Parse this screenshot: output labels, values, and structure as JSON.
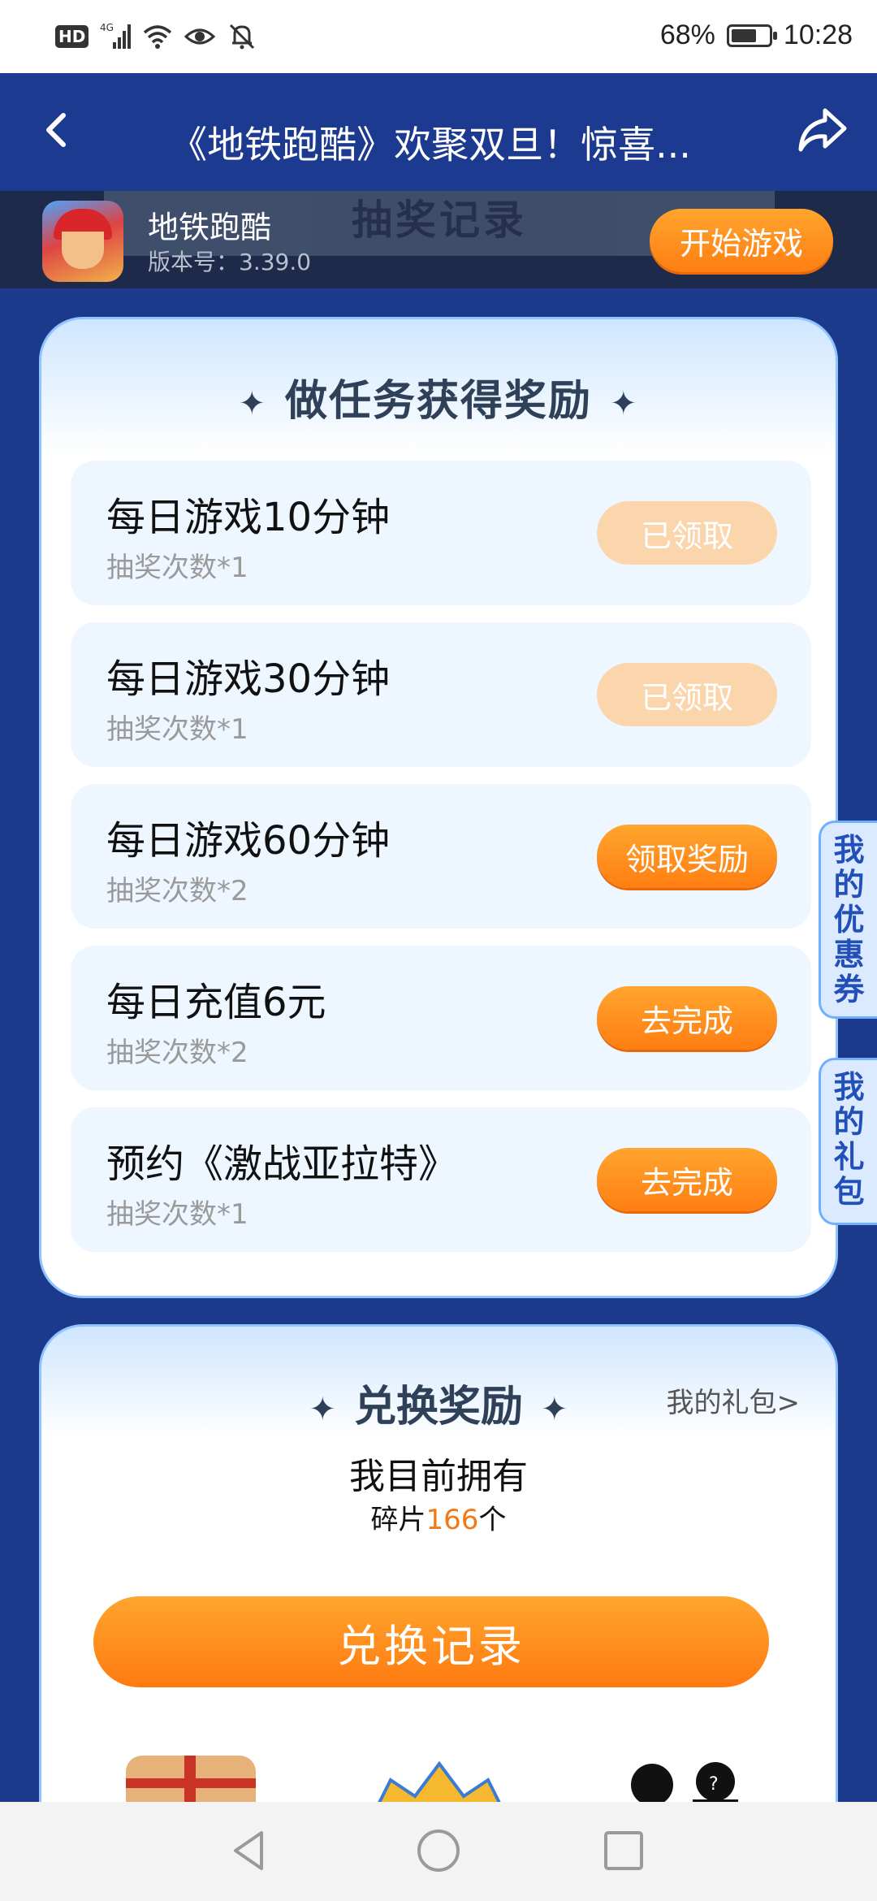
{
  "status_bar": {
    "hd": "HD",
    "network": "4G",
    "battery_pct": "68%",
    "battery_level": 0.68,
    "time": "10:28"
  },
  "header": {
    "title": "《地铁跑酷》欢聚双旦！惊喜...",
    "back_icon": "back-chevron-icon",
    "share_icon": "share-arrow-icon"
  },
  "game_bar": {
    "ghost_tab_text": "抽奖记录",
    "name": "地铁跑酷",
    "version": "版本号：3.39.0",
    "start_label": "开始游戏"
  },
  "task_card": {
    "title": "做任务获得奖励",
    "tasks": [
      {
        "name": "每日游戏10分钟",
        "sub": "抽奖次数*1",
        "button": "已领取",
        "state": "done"
      },
      {
        "name": "每日游戏30分钟",
        "sub": "抽奖次数*1",
        "button": "已领取",
        "state": "done"
      },
      {
        "name": "每日游戏60分钟",
        "sub": "抽奖次数*2",
        "button": "领取奖励",
        "state": "active"
      },
      {
        "name": "每日充值6元",
        "sub": "抽奖次数*2",
        "button": "去完成",
        "state": "active"
      },
      {
        "name": "预约《激战亚拉特》",
        "sub": "抽奖次数*1",
        "button": "去完成",
        "state": "active"
      }
    ]
  },
  "side_tabs": {
    "coupons": "我的优惠券",
    "gifts": "我的礼包"
  },
  "exchange": {
    "title": "兑换奖励",
    "my_gift_link": "我的礼包>",
    "own_label": "我目前拥有",
    "fragments_prefix": "碎片",
    "fragments_count": "166",
    "fragments_suffix": "个",
    "record_button": "兑换记录"
  },
  "colors": {
    "primary_blue": "#1c3a8f",
    "accent_orange": "#ff8a1c",
    "done_button": "#fbd6ad"
  }
}
